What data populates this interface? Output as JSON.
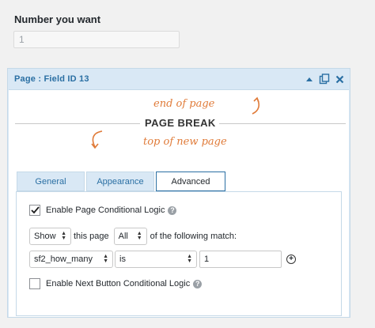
{
  "field_top": {
    "label": "Number you want",
    "placeholder": "1"
  },
  "panel": {
    "title": "Page : Field ID 13",
    "icons": [
      "collapse-arrow-icon",
      "duplicate-icon",
      "delete-icon"
    ]
  },
  "page_break": {
    "end_label": "end of page",
    "title": "PAGE BREAK",
    "start_label": "top of new page"
  },
  "tabs": [
    {
      "label": "General"
    },
    {
      "label": "Appearance"
    },
    {
      "label": "Advanced"
    }
  ],
  "advanced": {
    "conditional_label": "Enable Page Conditional Logic",
    "action_select": "Show",
    "this_page_text": "this page",
    "match_select": "All",
    "match_text": "of the following match:",
    "rule_field": "sf2_how_many",
    "rule_operator": "is",
    "rule_value": "1",
    "next_button_label": "Enable Next Button Conditional Logic"
  },
  "colors": {
    "accent": "#2a6fa3",
    "annotation": "#e07b39",
    "panel_bg": "#d9e8f5"
  }
}
